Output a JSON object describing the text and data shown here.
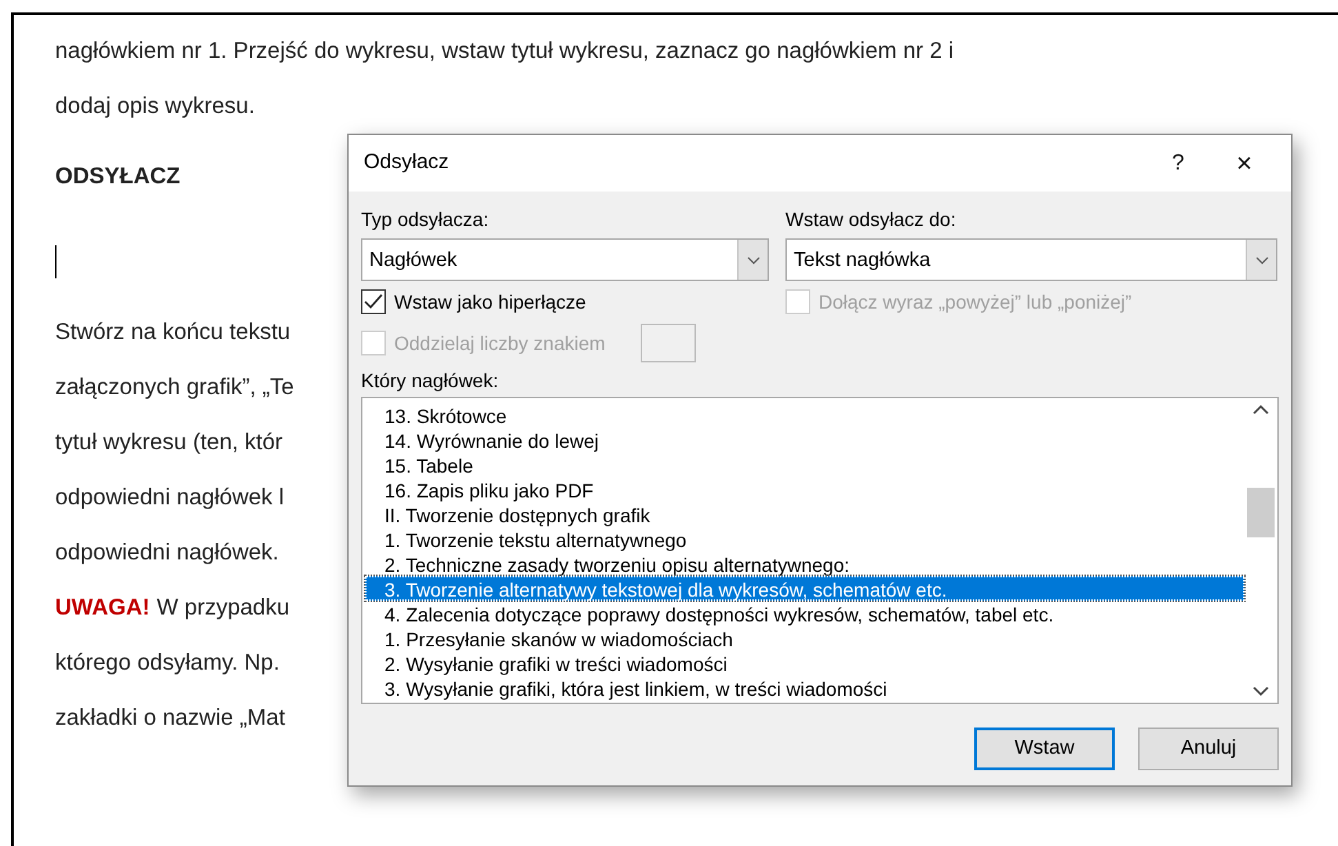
{
  "document": {
    "lines": [
      {
        "kind": "text",
        "text": "nagłówkiem nr 1. Przejść do wykresu, wstaw tytuł wykresu, zaznacz go nagłówkiem nr 2 i"
      },
      {
        "kind": "text",
        "text": "dodaj opis wykresu."
      },
      {
        "kind": "heading",
        "text": "ODSYŁACZ"
      },
      {
        "kind": "cursor"
      },
      {
        "kind": "text",
        "text": "Stwórz na końcu tekstu"
      },
      {
        "kind": "text",
        "text": "załączonych grafik”, „Te"
      },
      {
        "kind": "text",
        "text": "tytuł wykresu (ten, któr"
      },
      {
        "kind": "text",
        "text": "odpowiedni nagłówek l"
      },
      {
        "kind": "text",
        "text": "odpowiedni nagłówek."
      },
      {
        "kind": "warning",
        "label": "UWAGA!",
        "text": "W przypadku"
      },
      {
        "kind": "text",
        "text": "którego odsyłamy. Np."
      },
      {
        "kind": "text",
        "text": "zakładki o nazwie „Mat"
      }
    ]
  },
  "dialog": {
    "title": "Odsyłacz",
    "help": "?",
    "close": "×",
    "type_field": {
      "label": "Typ odsyłacza:",
      "value": "Nagłówek"
    },
    "insert_field": {
      "label": "Wstaw odsyłacz do:",
      "value": "Tekst nagłówka"
    },
    "options": [
      {
        "label": "Wstaw jako hiperłącze",
        "checked": true,
        "disabled": false
      },
      {
        "label": "Dołącz wyraz „powyżej” lub „poniżej”",
        "checked": false,
        "disabled": true
      },
      {
        "label": "Oddzielaj liczby znakiem",
        "checked": false,
        "disabled": true
      }
    ],
    "list_label": "Który nagłówek:",
    "headings": [
      {
        "label": "13. Skrótowce",
        "selected": false
      },
      {
        "label": "14. Wyrównanie do lewej",
        "selected": false
      },
      {
        "label": "15. Tabele",
        "selected": false
      },
      {
        "label": "16. Zapis pliku jako PDF",
        "selected": false
      },
      {
        "label": "II. Tworzenie dostępnych grafik",
        "selected": false
      },
      {
        "label": "1. Tworzenie tekstu alternatywnego",
        "selected": false
      },
      {
        "label": "2. Techniczne zasady tworzeniu opisu alternatywnego:",
        "selected": false
      },
      {
        "label": "3. Tworzenie alternatywy tekstowej dla wykresów, schematów etc.",
        "selected": true
      },
      {
        "label": "4. Zalecenia dotyczące poprawy dostępności wykresów, schematów, tabel etc.",
        "selected": false
      },
      {
        "label": "1. Przesyłanie skanów w wiadomościach",
        "selected": false
      },
      {
        "label": "2. Wysyłanie grafiki w treści wiadomości",
        "selected": false
      },
      {
        "label": "3. Wysyłanie grafiki, która jest linkiem, w treści wiadomości",
        "selected": false
      }
    ],
    "buttons": [
      {
        "label": "Wstaw",
        "default": true
      },
      {
        "label": "Anuluj",
        "default": false
      }
    ]
  }
}
